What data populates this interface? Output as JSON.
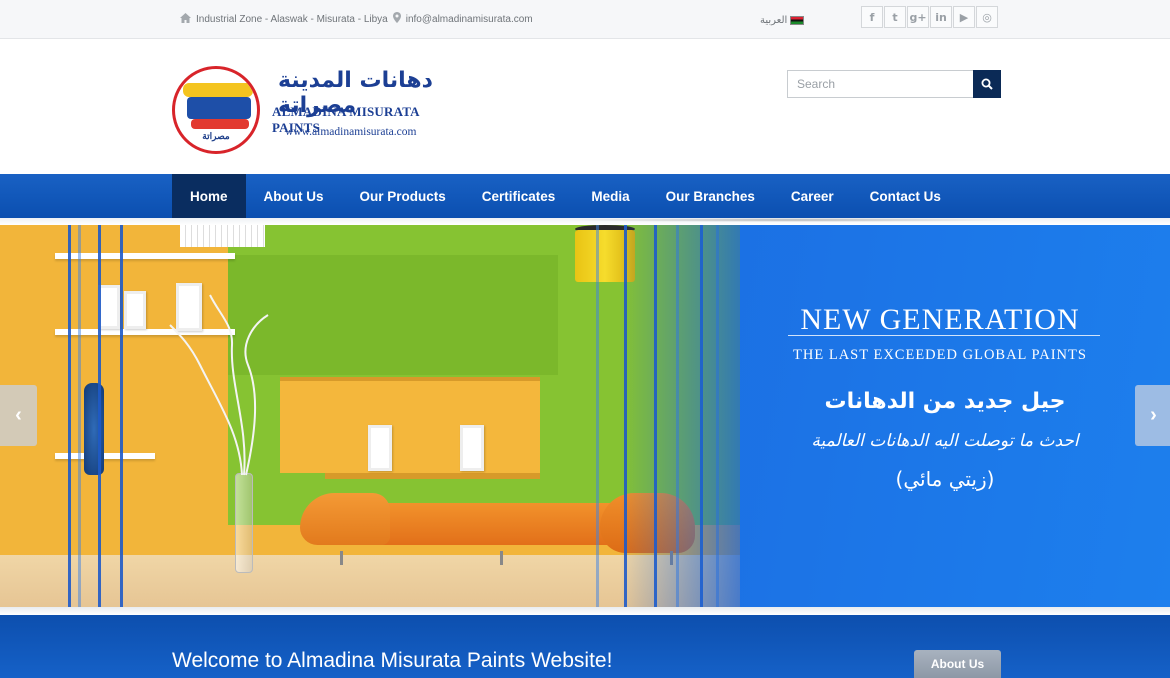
{
  "topbar": {
    "address": "Industrial Zone - Alaswak - Misurata - Libya",
    "email": "info@almadinamisurata.com",
    "language": "العربية",
    "social": [
      {
        "icon": "facebook-icon",
        "glyph": "f"
      },
      {
        "icon": "twitter-icon",
        "glyph": "t"
      },
      {
        "icon": "google-plus-icon",
        "glyph": "g+"
      },
      {
        "icon": "linkedin-icon",
        "glyph": "in"
      },
      {
        "icon": "youtube-icon",
        "glyph": "▶"
      },
      {
        "icon": "instagram-icon",
        "glyph": "◎"
      }
    ]
  },
  "header": {
    "logo_arabic": "دهانات المدينة مصراتة",
    "logo_english": "ALMADINA MISURATA PAINTS",
    "logo_url": "www.almadinamisurata.com",
    "logo_emblem_text": "مصراتة",
    "search_placeholder": "Search"
  },
  "nav": {
    "items": [
      {
        "label": "Home",
        "active": true
      },
      {
        "label": "About Us",
        "active": false
      },
      {
        "label": "Our Products",
        "active": false
      },
      {
        "label": "Certificates",
        "active": false
      },
      {
        "label": "Media",
        "active": false
      },
      {
        "label": "Our Branches",
        "active": false
      },
      {
        "label": "Career",
        "active": false
      },
      {
        "label": "Contact Us",
        "active": false
      }
    ]
  },
  "slider": {
    "headline": "NEW GENERATION",
    "subheadline": "THE LAST EXCEEDED GLOBAL PAINTS",
    "arabic_line1": "جيل جديد من الدهانات",
    "arabic_line2": "احدث ما توصلت اليه الدهانات العالمية",
    "arabic_line3": "(زيتي مائي)",
    "prev_glyph": "‹",
    "next_glyph": "›"
  },
  "welcome": {
    "title": "Welcome to Almadina Misurata Paints Website!",
    "about_button": "About Us"
  },
  "colors": {
    "nav_blue": "#1961c4",
    "nav_active": "#0a2d60",
    "search_button": "#0b2a56",
    "brand_blue": "#1c3f94"
  }
}
